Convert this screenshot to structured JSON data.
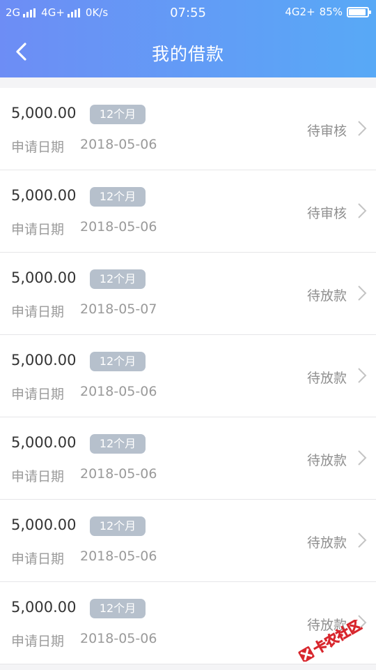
{
  "status_bar": {
    "network1": "2G",
    "network2": "4G+",
    "speed": "0K/s",
    "time": "07:55",
    "network3": "4G2+",
    "battery": "85%",
    "battery_level": 0.85
  },
  "header": {
    "title": "我的借款",
    "back_icon": "chevron-left-icon"
  },
  "colors": {
    "header_gradient_start": "#6d8df5",
    "header_gradient_end": "#58a9f6",
    "badge": "#b6c0cc"
  },
  "date_label": "申请日期",
  "loans": [
    {
      "amount": "5,000.00",
      "term": "12个月",
      "date": "2018-05-06",
      "status": "待审核"
    },
    {
      "amount": "5,000.00",
      "term": "12个月",
      "date": "2018-05-06",
      "status": "待审核"
    },
    {
      "amount": "5,000.00",
      "term": "12个月",
      "date": "2018-05-07",
      "status": "待放款"
    },
    {
      "amount": "5,000.00",
      "term": "12个月",
      "date": "2018-05-06",
      "status": "待放款"
    },
    {
      "amount": "5,000.00",
      "term": "12个月",
      "date": "2018-05-06",
      "status": "待放款"
    },
    {
      "amount": "5,000.00",
      "term": "12个月",
      "date": "2018-05-06",
      "status": "待放款"
    },
    {
      "amount": "5,000.00",
      "term": "12个月",
      "date": "2018-05-06",
      "status": "待放款"
    }
  ],
  "watermark": "卡农社区"
}
